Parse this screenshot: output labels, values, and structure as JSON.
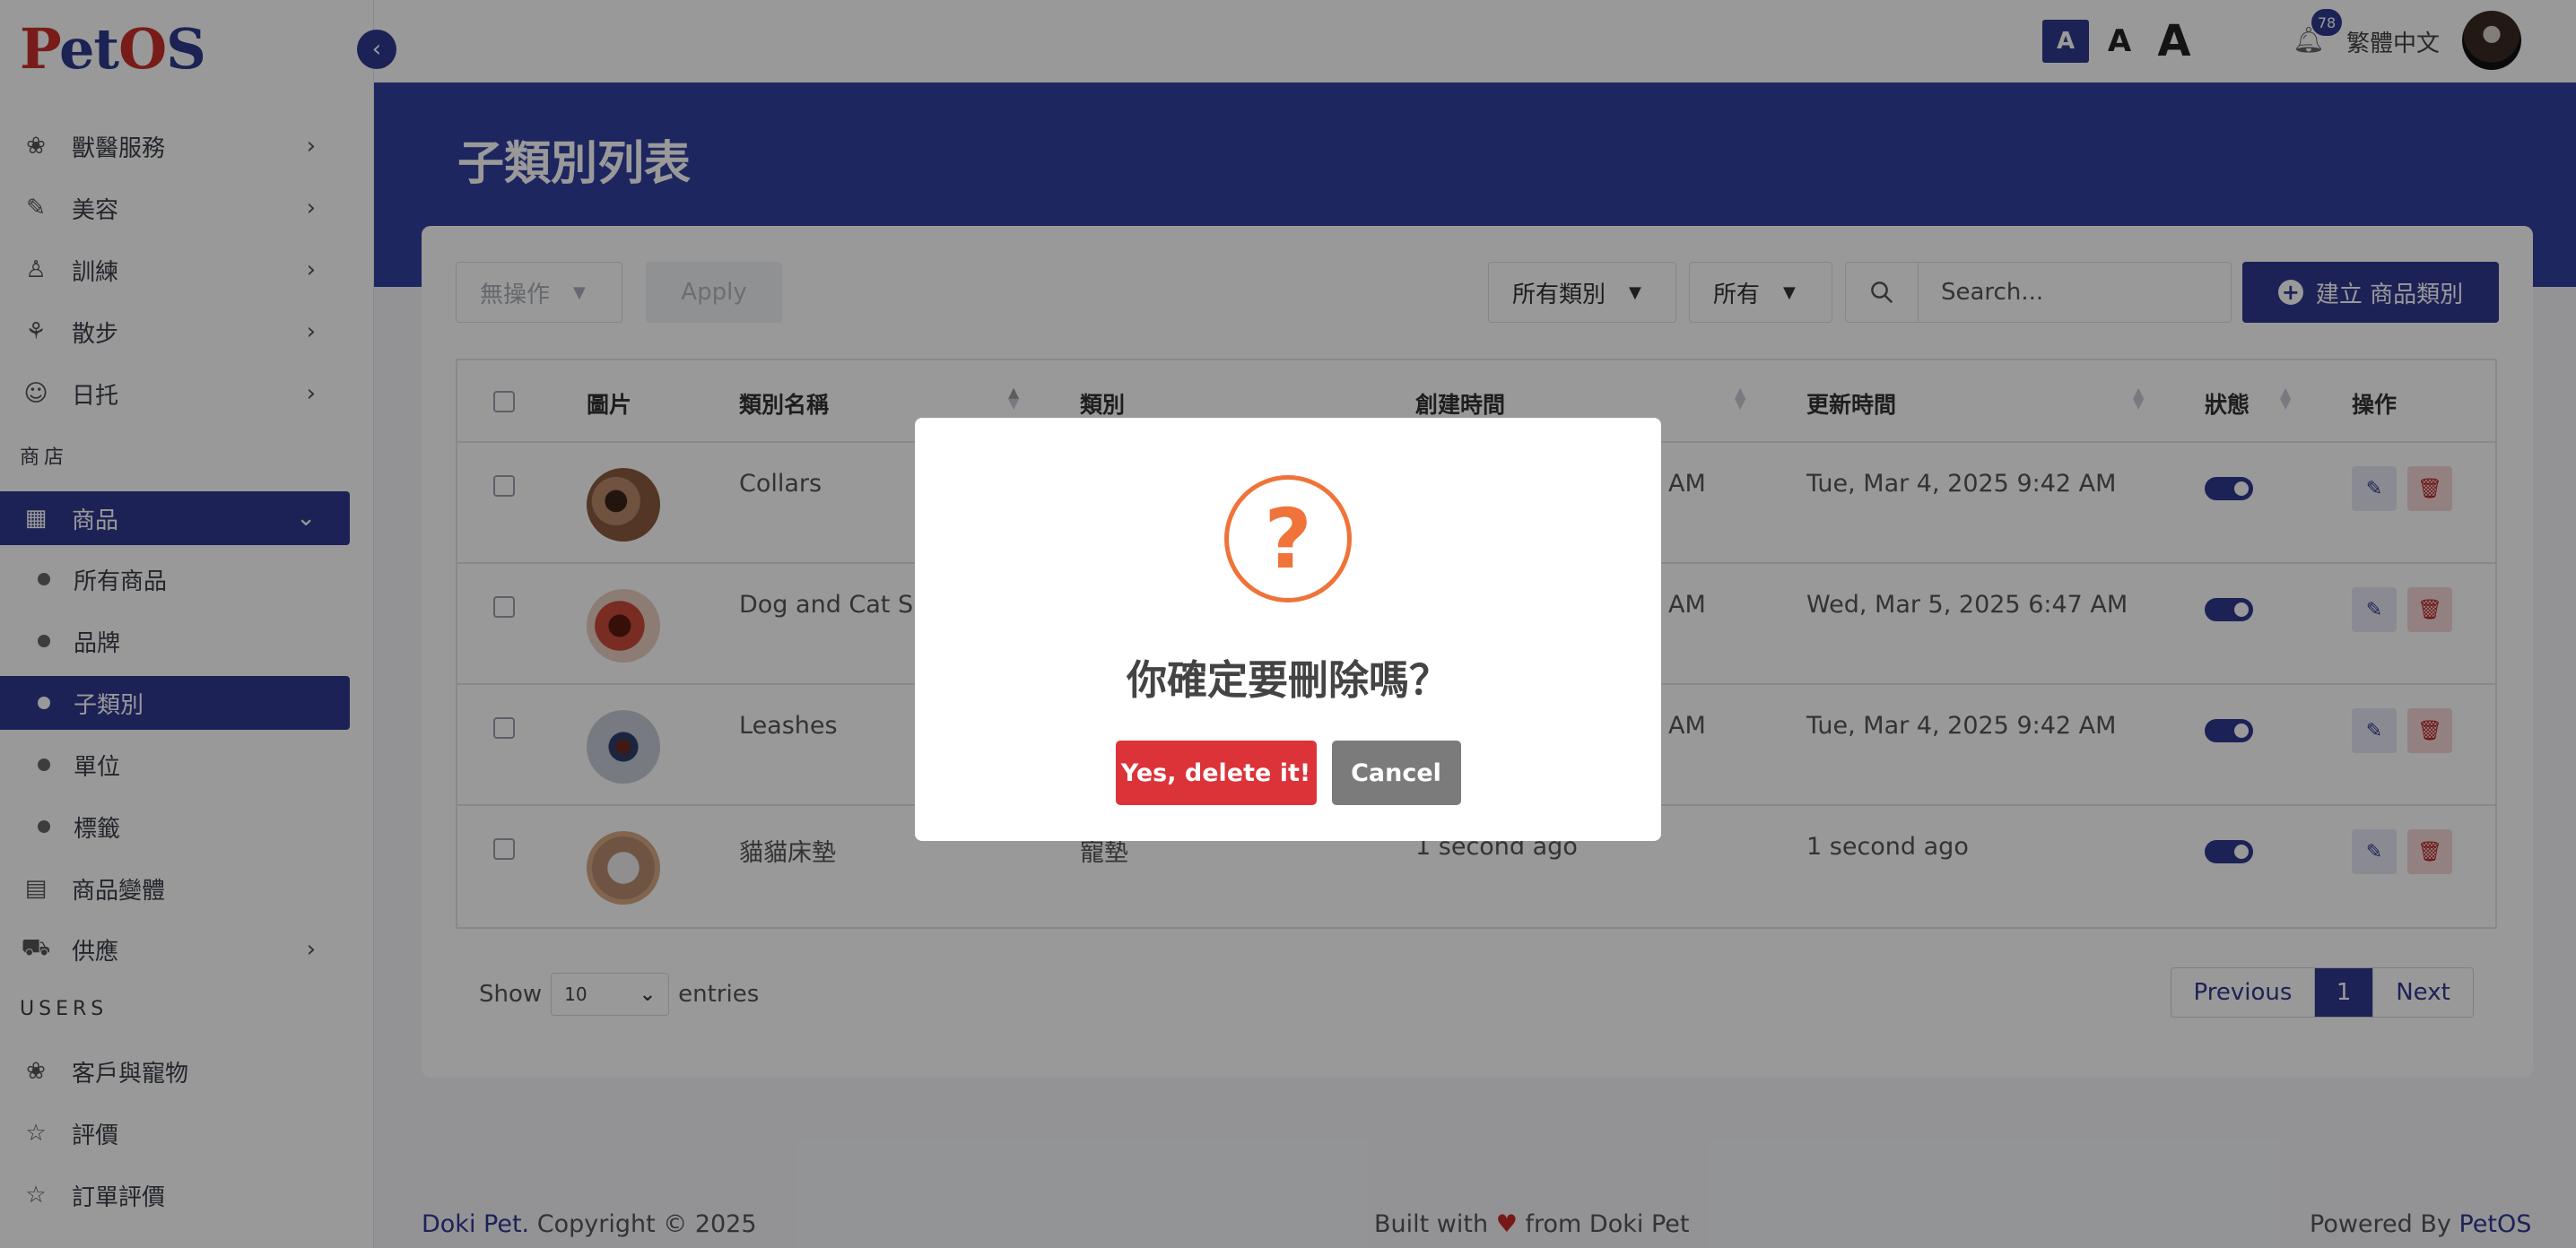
{
  "app": {
    "logo": "PetOS"
  },
  "sidebar": {
    "groups1": [
      {
        "label": "獸醫服務",
        "icon": "paw-icon"
      },
      {
        "label": "美容",
        "icon": "brush-icon"
      },
      {
        "label": "訓練",
        "icon": "whistle-icon"
      },
      {
        "label": "散步",
        "icon": "dog-walk-icon"
      },
      {
        "label": "日托",
        "icon": "pet-face-icon"
      }
    ],
    "shop_section": "商店",
    "shop_item": "商品",
    "shop_sub": [
      "所有商品",
      "品牌",
      "子類別",
      "單位",
      "標籤"
    ],
    "variants": "商品變體",
    "supply": "供應",
    "users_section": "USERS",
    "users_items": [
      "客戶與寵物",
      "評價",
      "訂單評價"
    ]
  },
  "header": {
    "font_small": "A",
    "font_medium": "A",
    "font_large": "A",
    "notifications": "78",
    "language": "繁體中文"
  },
  "page": {
    "title": "子類別列表"
  },
  "toolbar": {
    "bulk_action": "無操作",
    "apply": "Apply",
    "category_filter": "所有類別",
    "status_filter": "所有",
    "search_placeholder": "Search...",
    "create": "建立 商品類別"
  },
  "table": {
    "headers": {
      "image": "圖片",
      "name": "類別名稱",
      "category": "類別",
      "created": "創建時間",
      "updated": "更新時間",
      "status": "狀態",
      "actions": "操作"
    },
    "rows": [
      {
        "name": "Collars",
        "category": "",
        "created": "AM",
        "updated": "Tue, Mar 4, 2025 9:42 AM",
        "status": true
      },
      {
        "name": "Dog and Cat Sup",
        "category": "",
        "created": "AM",
        "updated": "Wed, Mar 5, 2025 6:47 AM",
        "status": true
      },
      {
        "name": "Leashes",
        "category": "",
        "created": "AM",
        "updated": "Tue, Mar 4, 2025 9:42 AM",
        "status": true
      },
      {
        "name": "貓貓床墊",
        "category": "寵墊",
        "created": "1 second ago",
        "updated": "1 second ago",
        "status": true
      }
    ]
  },
  "length": {
    "show": "Show",
    "value": "10",
    "entries": "entries"
  },
  "pagination": {
    "previous": "Previous",
    "current": "1",
    "next": "Next"
  },
  "footer": {
    "brand": "Doki Pet.",
    "copyright": "Copyright © 2025",
    "built_pre": "Built with",
    "built_post": "from Doki Pet",
    "powered": "Powered By",
    "powered_brand": "PetOS"
  },
  "modal": {
    "title": "你確定要刪除嗎？",
    "confirm": "Yes, delete it!",
    "cancel": "Cancel",
    "icon": "question-icon"
  },
  "colors": {
    "primary": "#2f3a8f",
    "danger": "#dc3339",
    "warning": "#f0733a"
  }
}
